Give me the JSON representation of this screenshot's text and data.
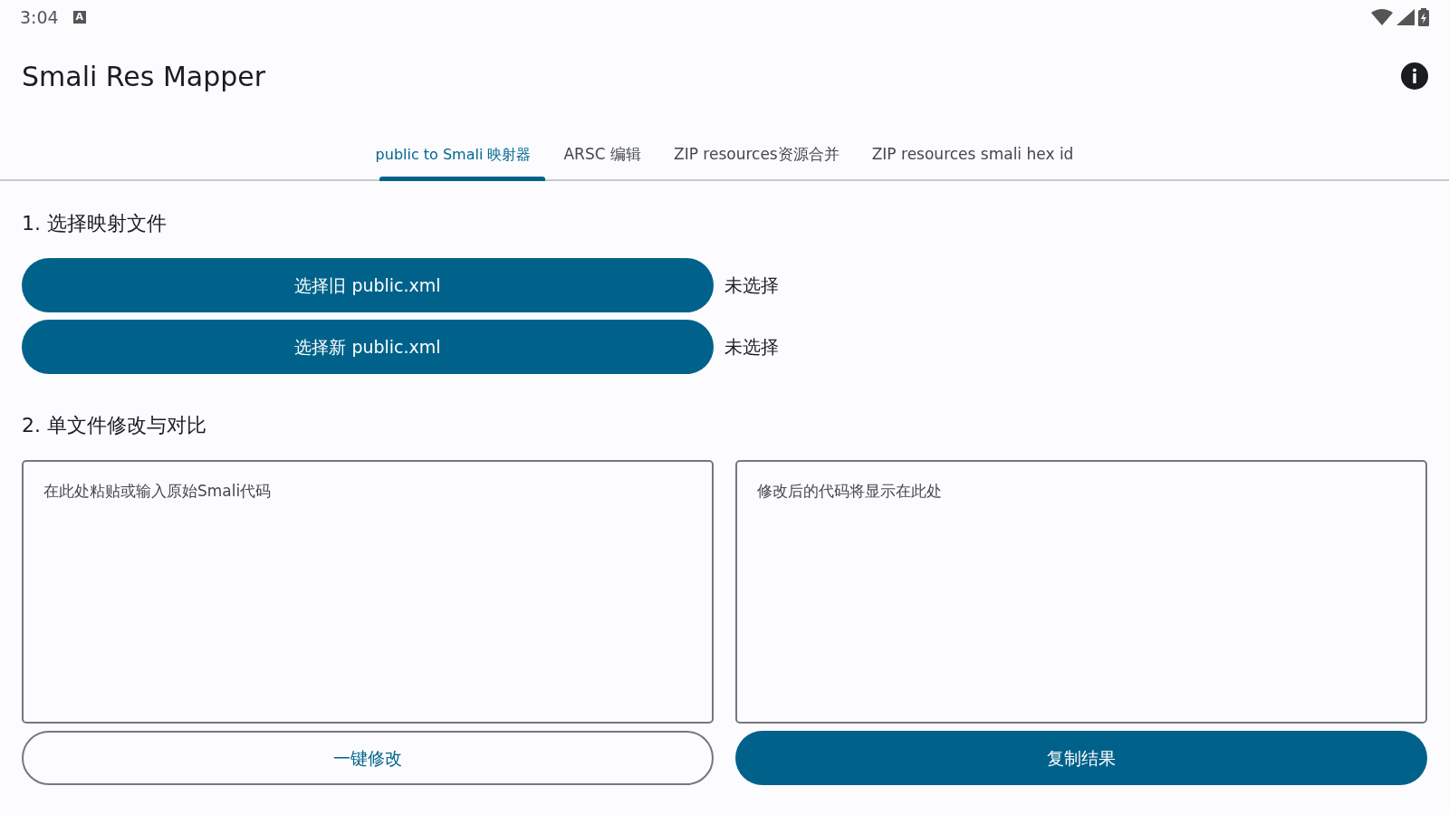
{
  "status_bar": {
    "time": "3:04",
    "notification_badge": "A"
  },
  "app_bar": {
    "title": "Smali Res Mapper"
  },
  "tabs": [
    {
      "label": "public to Smali 映射器",
      "selected": true
    },
    {
      "label": "ARSC 编辑",
      "selected": false
    },
    {
      "label": "ZIP resources资源合并",
      "selected": false
    },
    {
      "label": "ZIP resources smali hex id",
      "selected": false
    }
  ],
  "section_1": {
    "heading": "1. 选择映射文件",
    "files": [
      {
        "button": "选择旧 public.xml",
        "status": "未选择"
      },
      {
        "button": "选择新 public.xml",
        "status": "未选择"
      }
    ]
  },
  "section_2": {
    "heading": "2. 单文件修改与对比",
    "input": {
      "placeholder": "在此处粘贴或输入原始Smali代码"
    },
    "output": {
      "placeholder": "修改后的代码将显示在此处"
    },
    "buttons": [
      {
        "label": "一键修改",
        "kind": "outlined"
      },
      {
        "label": "复制结果",
        "kind": "filled"
      }
    ]
  }
}
